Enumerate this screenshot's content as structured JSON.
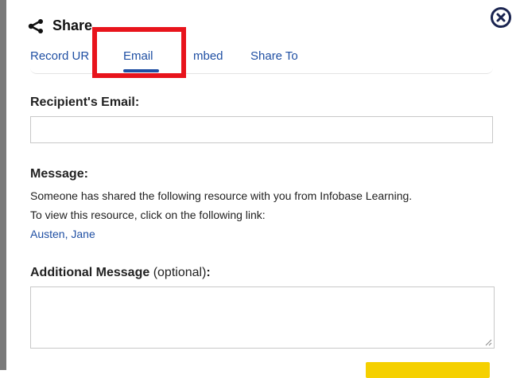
{
  "dialog": {
    "title": "Share",
    "close_icon": "close-circle-x-icon",
    "share_icon": "share-nodes-icon"
  },
  "tabs": [
    {
      "label": "Record URL",
      "visible_label": "Record UR",
      "active": false
    },
    {
      "label": "Email",
      "active": true
    },
    {
      "label": "Embed",
      "visible_label": "mbed",
      "active": false
    },
    {
      "label": "Share To",
      "active": false
    }
  ],
  "form": {
    "recipient_label": "Recipient's Email:",
    "recipient_value": "",
    "message_label": "Message:",
    "message_line1": "Someone has shared the following resource with you from Infobase Learning.",
    "message_line2": "To view this resource, click on the following link:",
    "message_link": "Austen, Jane",
    "additional_label": "Additional Message",
    "additional_optional": " (optional)",
    "additional_colon": ":",
    "additional_value": ""
  },
  "colors": {
    "link": "#1f4fa3",
    "highlight": "#e8141c",
    "send_button": "#f5d000"
  }
}
